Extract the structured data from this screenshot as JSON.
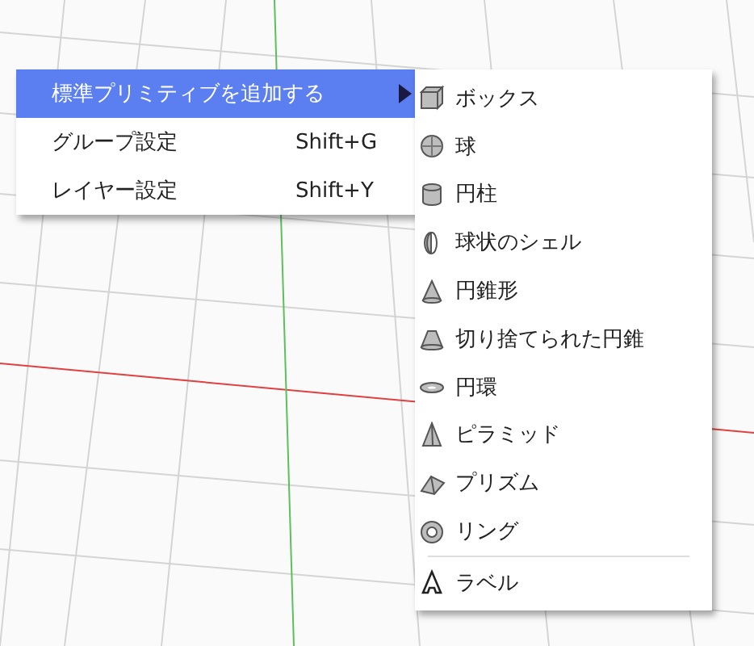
{
  "context_menu": {
    "items": [
      {
        "label": "標準プリミティブを追加する",
        "has_submenu": true,
        "selected": true
      },
      {
        "label": "グループ設定",
        "shortcut": "Shift+G",
        "has_submenu": false,
        "selected": false
      },
      {
        "label": "レイヤー設定",
        "shortcut": "Shift+Y",
        "has_submenu": false,
        "selected": false
      }
    ]
  },
  "submenu": {
    "items": [
      {
        "label": "ボックス",
        "kind": "box",
        "separator_before": false
      },
      {
        "label": "球",
        "kind": "sphere",
        "separator_before": false
      },
      {
        "label": "円柱",
        "kind": "cylinder",
        "separator_before": false
      },
      {
        "label": "球状のシェル",
        "kind": "shell",
        "separator_before": false
      },
      {
        "label": "円錐形",
        "kind": "cone",
        "separator_before": false
      },
      {
        "label": "切り捨てられた円錐",
        "kind": "frustum",
        "separator_before": false
      },
      {
        "label": "円環",
        "kind": "torus",
        "separator_before": false
      },
      {
        "label": "ピラミッド",
        "kind": "pyramid",
        "separator_before": false
      },
      {
        "label": "プリズム",
        "kind": "prism",
        "separator_before": false
      },
      {
        "label": "リング",
        "kind": "ring",
        "separator_before": false
      },
      {
        "label": "ラベル",
        "kind": "label",
        "separator_before": true
      }
    ]
  }
}
